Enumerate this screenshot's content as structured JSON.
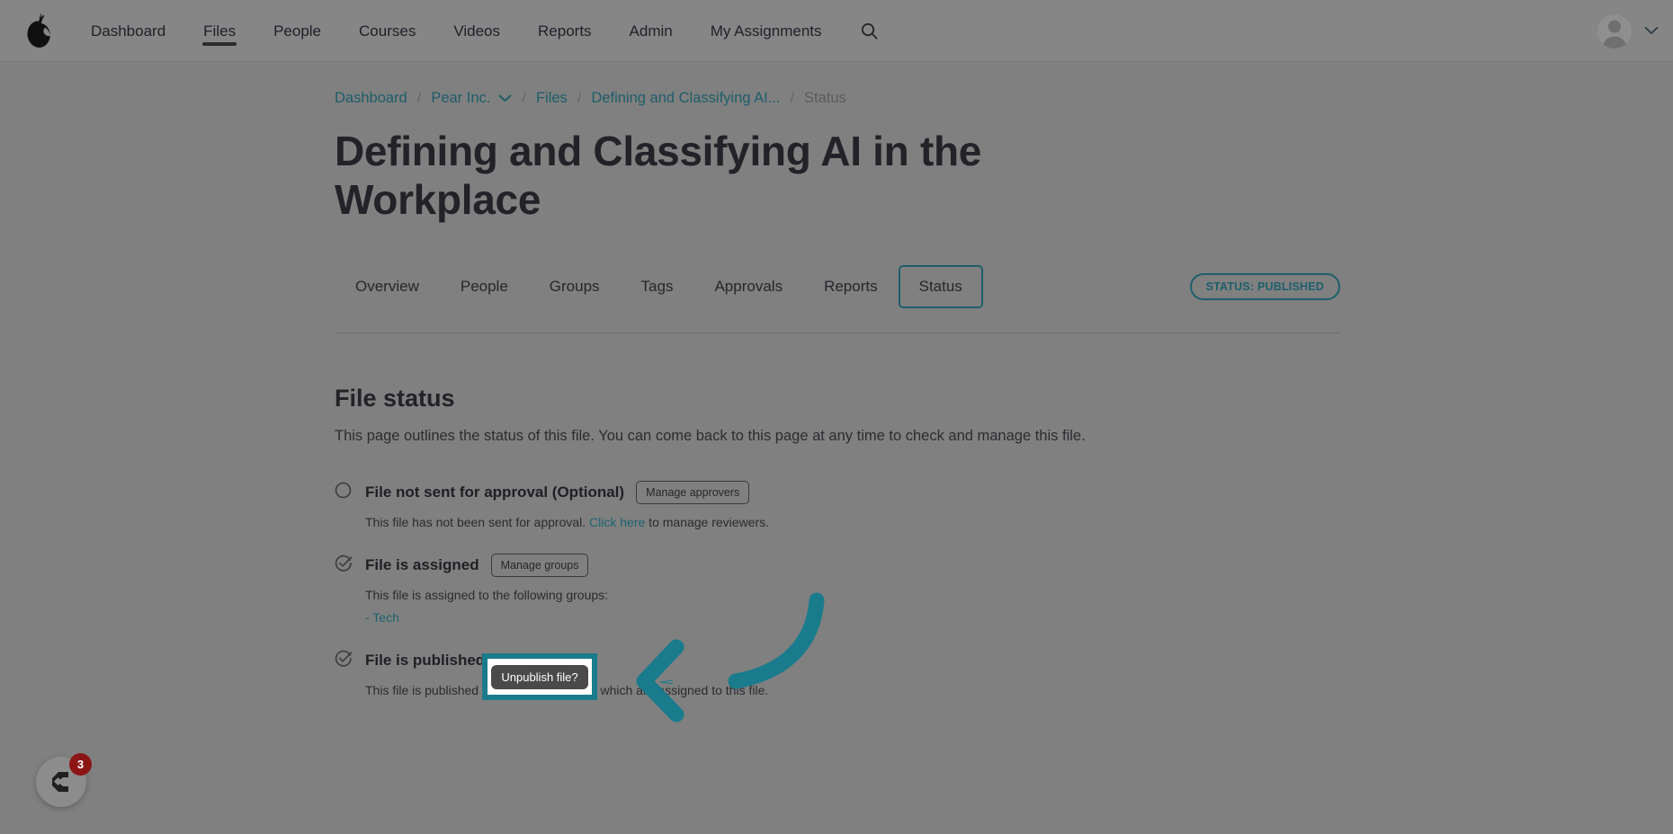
{
  "topnav": {
    "logo_icon": "pear-logo-icon",
    "links": [
      {
        "label": "Dashboard",
        "active": false
      },
      {
        "label": "Files",
        "active": true
      },
      {
        "label": "People",
        "active": false
      },
      {
        "label": "Courses",
        "active": false
      },
      {
        "label": "Videos",
        "active": false
      },
      {
        "label": "Reports",
        "active": false
      },
      {
        "label": "Admin",
        "active": false
      },
      {
        "label": "My Assignments",
        "active": false
      }
    ],
    "search_icon": "search-icon",
    "avatar_icon": "user-avatar-icon",
    "account_caret_icon": "chevron-down-icon"
  },
  "breadcrumb": {
    "items": [
      {
        "label": "Dashboard",
        "current": false,
        "caret": false
      },
      {
        "label": "Pear Inc.",
        "current": false,
        "caret": true
      },
      {
        "label": "Files",
        "current": false,
        "caret": false
      },
      {
        "label": "Defining and Classifying AI...",
        "current": false,
        "caret": false
      },
      {
        "label": "Status",
        "current": true,
        "caret": false
      }
    ],
    "separator": "/"
  },
  "page": {
    "title": "Defining and Classifying AI in the Workplace"
  },
  "tabs": {
    "items": [
      {
        "label": "Overview",
        "active": false
      },
      {
        "label": "People",
        "active": false
      },
      {
        "label": "Groups",
        "active": false
      },
      {
        "label": "Tags",
        "active": false
      },
      {
        "label": "Approvals",
        "active": false
      },
      {
        "label": "Reports",
        "active": false
      },
      {
        "label": "Status",
        "active": true
      }
    ],
    "status_badge": "STATUS: PUBLISHED"
  },
  "section": {
    "heading": "File status",
    "description": "This page outlines the status of this file. You can come back to this page at any time to check and manage this file."
  },
  "status_items": [
    {
      "icon": "circle-empty-icon",
      "label": "File not sent for approval (Optional)",
      "button": "Manage approvers",
      "sub_before": "This file has not been sent for approval. ",
      "sub_link": "Click here",
      "sub_after": " to manage reviewers.",
      "group": ""
    },
    {
      "icon": "check-circle-icon",
      "label": "File is assigned",
      "button": "Manage groups",
      "sub_before": "This file is assigned to the following groups:",
      "sub_link": "",
      "sub_after": "",
      "group": "- Tech"
    },
    {
      "icon": "check-circle-icon",
      "label": "File is published",
      "button": "",
      "sub_before": "This file is published and visible to people which are assigned to this file.",
      "sub_link": "",
      "sub_after": "",
      "group": ""
    }
  ],
  "highlight": {
    "button_label": "Unpublish file?",
    "border_color": "#1a7b8c",
    "button_bg": "#4a4a4a",
    "arrow_color": "#1a7b8c",
    "arrow_icon": "curved-arrow-left-icon"
  },
  "help_widget": {
    "icon": "help-chat-icon",
    "badge_count": "3",
    "badge_color": "#8c1616"
  },
  "colors": {
    "accent_teal": "#1a7b8c",
    "link": "#1d6270",
    "overlay_gray": "#808080"
  }
}
